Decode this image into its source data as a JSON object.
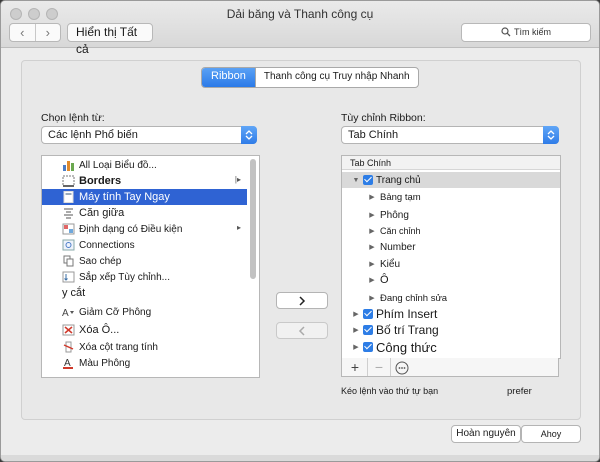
{
  "window": {
    "title": "Dải băng và Thanh công cụ"
  },
  "toolbar": {
    "back_glyph": "‹",
    "forward_glyph": "›",
    "show_all_label": "Hiển thị Tất cả",
    "search_placeholder": "Tìm kiếm"
  },
  "tabs": [
    {
      "label": "Ribbon",
      "active": true
    },
    {
      "label": "Thanh công cụ Truy nhập Nhanh",
      "active": false
    }
  ],
  "left": {
    "heading": "Chọn lệnh từ:",
    "dropdown_value": "Các lệnh Phổ biến",
    "commands": [
      {
        "label": "All Loại Biểu đồ...",
        "icon": "chart-icon",
        "has_submenu": false
      },
      {
        "label": "Borders",
        "icon": "borders-icon",
        "has_submenu": true,
        "bold": true
      },
      {
        "label": "Máy tính Tay Ngay",
        "icon": "calculator-icon",
        "has_submenu": false,
        "selected": true
      },
      {
        "label": "Căn giữa",
        "icon": "align-center-icon",
        "has_submenu": false
      },
      {
        "label": "Định dạng có Điều kiện",
        "icon": "conditional-format-icon",
        "has_submenu": true
      },
      {
        "label": "Connections",
        "icon": "connections-icon",
        "has_submenu": false
      },
      {
        "label": "Sao chép",
        "icon": "copy-icon",
        "has_submenu": false
      },
      {
        "label": "Sắp xếp Tùy chỉnh...",
        "icon": "sort-icon",
        "has_submenu": false
      },
      {
        "label": "y cắt",
        "icon": "",
        "has_submenu": false,
        "outdent": true
      },
      {
        "label": "Giảm Cỡ Phông",
        "icon": "decrease-font-icon",
        "has_submenu": false
      },
      {
        "label": "Xóa Ô...",
        "icon": "delete-cells-icon",
        "has_submenu": false
      },
      {
        "label": "Xóa cột trang tính",
        "icon": "delete-column-icon",
        "has_submenu": false
      },
      {
        "label": "Màu Phông",
        "icon": "font-color-icon",
        "has_submenu": true
      }
    ]
  },
  "right": {
    "heading": "Tùy chỉnh Ribbon:",
    "dropdown_value": "Tab Chính",
    "tree_header": "Tab Chính",
    "tree": [
      {
        "label": "Trang chủ",
        "level": 1,
        "checkbox": true,
        "expanded": true,
        "highlight": true
      },
      {
        "label": "Bảng tạm",
        "level": 2
      },
      {
        "label": "Phông",
        "level": 2
      },
      {
        "label": "Căn chỉnh",
        "level": 2
      },
      {
        "label": "Number",
        "level": 2
      },
      {
        "label": "Kiểu",
        "level": 2
      },
      {
        "label": "Ô",
        "level": 2
      },
      {
        "label": "Đang chỉnh sửa",
        "level": 2
      },
      {
        "label": "Phím Insert",
        "level": 1,
        "checkbox": true,
        "large": true
      },
      {
        "label": "Bố trí Trang",
        "level": 1,
        "checkbox": true,
        "large": true
      },
      {
        "label": "Công thức",
        "level": 1,
        "checkbox": true,
        "large": true
      }
    ],
    "tools": {
      "add": "+",
      "remove": "−",
      "more": "⋯"
    },
    "hint": "Kéo lệnh vào thứ tự bạn",
    "hint_suffix": "prefer"
  },
  "buttons": {
    "add_arrow": "›",
    "remove_arrow": "‹",
    "revert": "Hoàn nguyên",
    "save": "Ahoy"
  },
  "colors": {
    "accent": "#2f7ce8",
    "selection": "#2f63d3"
  }
}
